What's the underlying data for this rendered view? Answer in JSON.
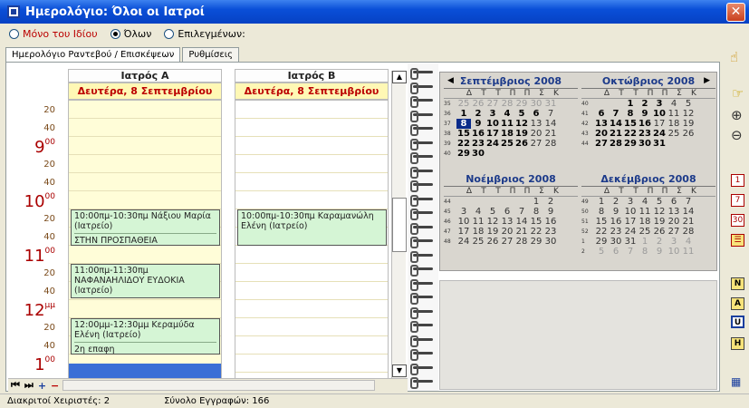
{
  "window": {
    "title": "Ημερολόγιο: Όλοι οι Ιατροί",
    "close_label": "✕"
  },
  "filters": [
    {
      "label": "Μόνο του Ιδίου",
      "selected": false
    },
    {
      "label": "Όλων",
      "selected": true
    },
    {
      "label": "Επιλεγμένων:",
      "selected": false
    }
  ],
  "tabs": [
    "Ημερολόγιο Ραντεβού / Επισκέψεων",
    "Ρυθμίσεις"
  ],
  "columns": [
    {
      "doctor": "Ιατρός Α",
      "date": "Δευτέρα, 8 Σεπτεμβρίου"
    },
    {
      "doctor": "Ιατρός Β",
      "date": "Δευτέρα, 8 Σεπτεμβρίου"
    }
  ],
  "time_labels": {
    "t1": "20",
    "t2": "40",
    "h9": "9",
    "h9m": "00",
    "t3": "20",
    "t4": "40",
    "h10": "10",
    "h10m": "00",
    "t5": "20",
    "t6": "40",
    "h11": "11",
    "h11m": "00",
    "t7": "20",
    "t8": "40",
    "h12": "12",
    "h12m": "μμ",
    "t9": "20",
    "t10": "40",
    "h1": "1",
    "h1m": "00"
  },
  "appointments": [
    {
      "text": "10:00πμ-10:30πμ Νάξιου Μαρία (Ιατρείο)",
      "note": "ΣΤΗΝ ΠΡΟΣΠΑΘΕΙΑ"
    },
    {
      "text": "11:00πμ-11:30πμ ΝΑΦΑΝΑΗΛΙΔΟΥ ΕΥΔΟΚΙΑ (Ιατρείο)",
      "note": ""
    },
    {
      "text": "12:00μμ-12:30μμ Κεραμύδα Ελένη (Ιατρείο)",
      "note": "2η επαφη"
    },
    {
      "text": "10:00πμ-10:30πμ Καραμανώλη Ελένη (Ιατρείο)",
      "note": ""
    }
  ],
  "calendar": {
    "dow": [
      "Δ",
      "Τ",
      "Τ",
      "Π",
      "Π",
      "Σ",
      "Κ"
    ],
    "months": [
      {
        "title": "Σεπτέμβριος 2008",
        "weeks": [
          {
            "n": "35",
            "days": [
              "25",
              "26",
              "27",
              "28",
              "29",
              "30",
              "31"
            ]
          },
          {
            "n": "36",
            "days": [
              "1",
              "2",
              "3",
              "4",
              "5",
              "6",
              "7"
            ]
          },
          {
            "n": "37",
            "days": [
              "8",
              "9",
              "10",
              "11",
              "12",
              "13",
              "14"
            ]
          },
          {
            "n": "38",
            "days": [
              "15",
              "16",
              "17",
              "18",
              "19",
              "20",
              "21"
            ]
          },
          {
            "n": "39",
            "days": [
              "22",
              "23",
              "24",
              "25",
              "26",
              "27",
              "28"
            ]
          },
          {
            "n": "40",
            "days": [
              "29",
              "30",
              "",
              "",
              "",
              "",
              ""
            ]
          }
        ]
      },
      {
        "title": "Οκτώβριος 2008",
        "weeks": [
          {
            "n": "40",
            "days": [
              "",
              "",
              "1",
              "2",
              "3",
              "4",
              "5"
            ]
          },
          {
            "n": "41",
            "days": [
              "6",
              "7",
              "8",
              "9",
              "10",
              "11",
              "12"
            ]
          },
          {
            "n": "42",
            "days": [
              "13",
              "14",
              "15",
              "16",
              "17",
              "18",
              "19"
            ]
          },
          {
            "n": "43",
            "days": [
              "20",
              "21",
              "22",
              "23",
              "24",
              "25",
              "26"
            ]
          },
          {
            "n": "44",
            "days": [
              "27",
              "28",
              "29",
              "30",
              "31",
              "",
              ""
            ]
          }
        ]
      },
      {
        "title": "Νοέμβριος 2008",
        "weeks": [
          {
            "n": "44",
            "days": [
              "",
              "",
              "",
              "",
              "",
              "1",
              "2"
            ]
          },
          {
            "n": "45",
            "days": [
              "3",
              "4",
              "5",
              "6",
              "7",
              "8",
              "9"
            ]
          },
          {
            "n": "46",
            "days": [
              "10",
              "11",
              "12",
              "13",
              "14",
              "15",
              "16"
            ]
          },
          {
            "n": "47",
            "days": [
              "17",
              "18",
              "19",
              "20",
              "21",
              "22",
              "23"
            ]
          },
          {
            "n": "48",
            "days": [
              "24",
              "25",
              "26",
              "27",
              "28",
              "29",
              "30"
            ]
          }
        ]
      },
      {
        "title": "Δεκέμβριος 2008",
        "weeks": [
          {
            "n": "49",
            "days": [
              "1",
              "2",
              "3",
              "4",
              "5",
              "6",
              "7"
            ]
          },
          {
            "n": "50",
            "days": [
              "8",
              "9",
              "10",
              "11",
              "12",
              "13",
              "14"
            ]
          },
          {
            "n": "51",
            "days": [
              "15",
              "16",
              "17",
              "18",
              "19",
              "20",
              "21"
            ]
          },
          {
            "n": "52",
            "days": [
              "22",
              "23",
              "24",
              "25",
              "26",
              "27",
              "28"
            ]
          },
          {
            "n": "1",
            "days": [
              "29",
              "30",
              "31",
              "1",
              "2",
              "3",
              "4"
            ]
          },
          {
            "n": "2",
            "days": [
              "5",
              "6",
              "7",
              "8",
              "9",
              "10",
              "11"
            ]
          }
        ]
      }
    ],
    "selected_day": "8"
  },
  "toolbar": {
    "first": "⏮",
    "last": "⏭",
    "add": "+",
    "remove": "−"
  },
  "status": {
    "users": "Διακριτοί Χειριστές: 2",
    "records": "Σύνολο Εγγραφών: 166"
  },
  "right_icons": [
    "1",
    "7",
    "30",
    "N",
    "A",
    "U",
    "H"
  ]
}
